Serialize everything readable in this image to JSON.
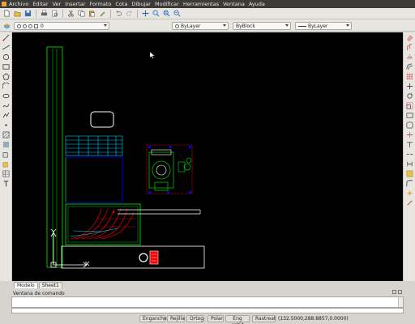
{
  "menubar": {
    "items": [
      "Archivo",
      "Editar",
      "Ver",
      "Insertar",
      "Formato",
      "Cota",
      "Dibujar",
      "Modificar",
      "Herramientas",
      "Ventana",
      "Ayuda"
    ]
  },
  "layer_bar": {
    "layer_value": "0",
    "color_value": "ByLayer",
    "linetype_value": "ByBlock",
    "lineweight_value": "ByLayer"
  },
  "tabs": [
    "Modelo",
    "Sheet1"
  ],
  "command_window": {
    "title": "Ventana de comando"
  },
  "statusbar": {
    "buttons": [
      "Enganche",
      "Rejilla",
      "Ortog",
      "Polar",
      "Eng entid",
      "Rastreat"
    ],
    "coordinates": "(132.5000,288.8857,0.0000)"
  },
  "colors": {
    "canvas": "#000000",
    "green": "#00c000",
    "cyan": "#00c8ff",
    "red": "#ff0000",
    "white": "#ffffff",
    "blue": "#0000ff"
  }
}
